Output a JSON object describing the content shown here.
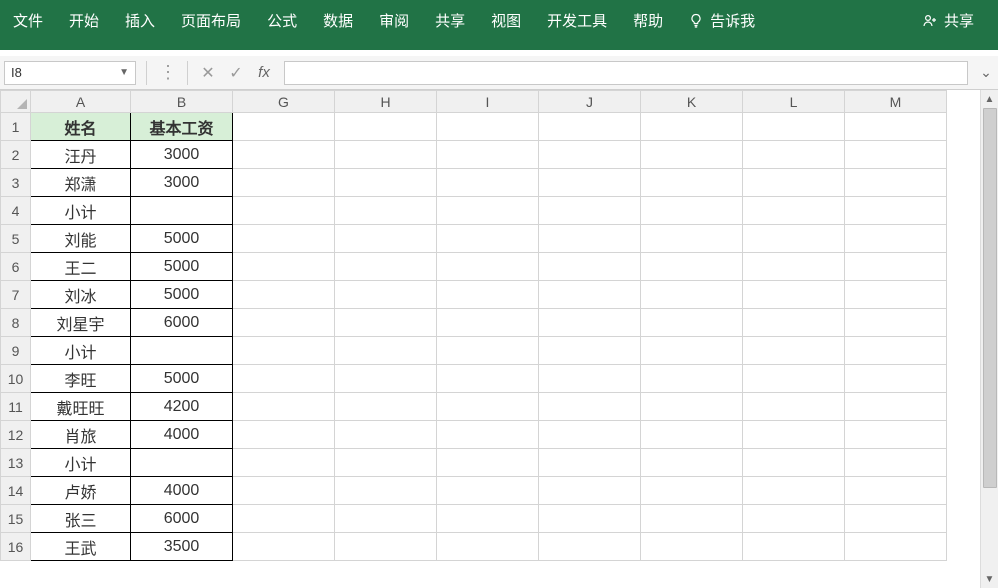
{
  "ribbon": {
    "tabs": [
      "文件",
      "开始",
      "插入",
      "页面布局",
      "公式",
      "数据",
      "审阅",
      "共享",
      "视图",
      "开发工具",
      "帮助"
    ],
    "tell_me": "告诉我",
    "share": "共享"
  },
  "formula_bar": {
    "name_box": "I8",
    "fx_label": "fx",
    "formula": ""
  },
  "columns": [
    "A",
    "B",
    "G",
    "H",
    "I",
    "J",
    "K",
    "L",
    "M"
  ],
  "row_numbers": [
    1,
    2,
    3,
    4,
    5,
    6,
    7,
    8,
    9,
    10,
    11,
    12,
    13,
    14,
    15,
    16
  ],
  "headers": {
    "A": "姓名",
    "B": "基本工资"
  },
  "rows": [
    {
      "A": "汪丹",
      "B": "3000"
    },
    {
      "A": "郑潇",
      "B": "3000"
    },
    {
      "A": "小计",
      "B": ""
    },
    {
      "A": "刘能",
      "B": "5000"
    },
    {
      "A": "王二",
      "B": "5000"
    },
    {
      "A": "刘冰",
      "B": "5000"
    },
    {
      "A": "刘星宇",
      "B": "6000"
    },
    {
      "A": "小计",
      "B": ""
    },
    {
      "A": "李旺",
      "B": "5000"
    },
    {
      "A": "戴旺旺",
      "B": "4200"
    },
    {
      "A": "肖旅",
      "B": "4000"
    },
    {
      "A": "小计",
      "B": ""
    },
    {
      "A": "卢娇",
      "B": "4000"
    },
    {
      "A": "张三",
      "B": "6000"
    },
    {
      "A": "王武",
      "B": "3500"
    }
  ]
}
